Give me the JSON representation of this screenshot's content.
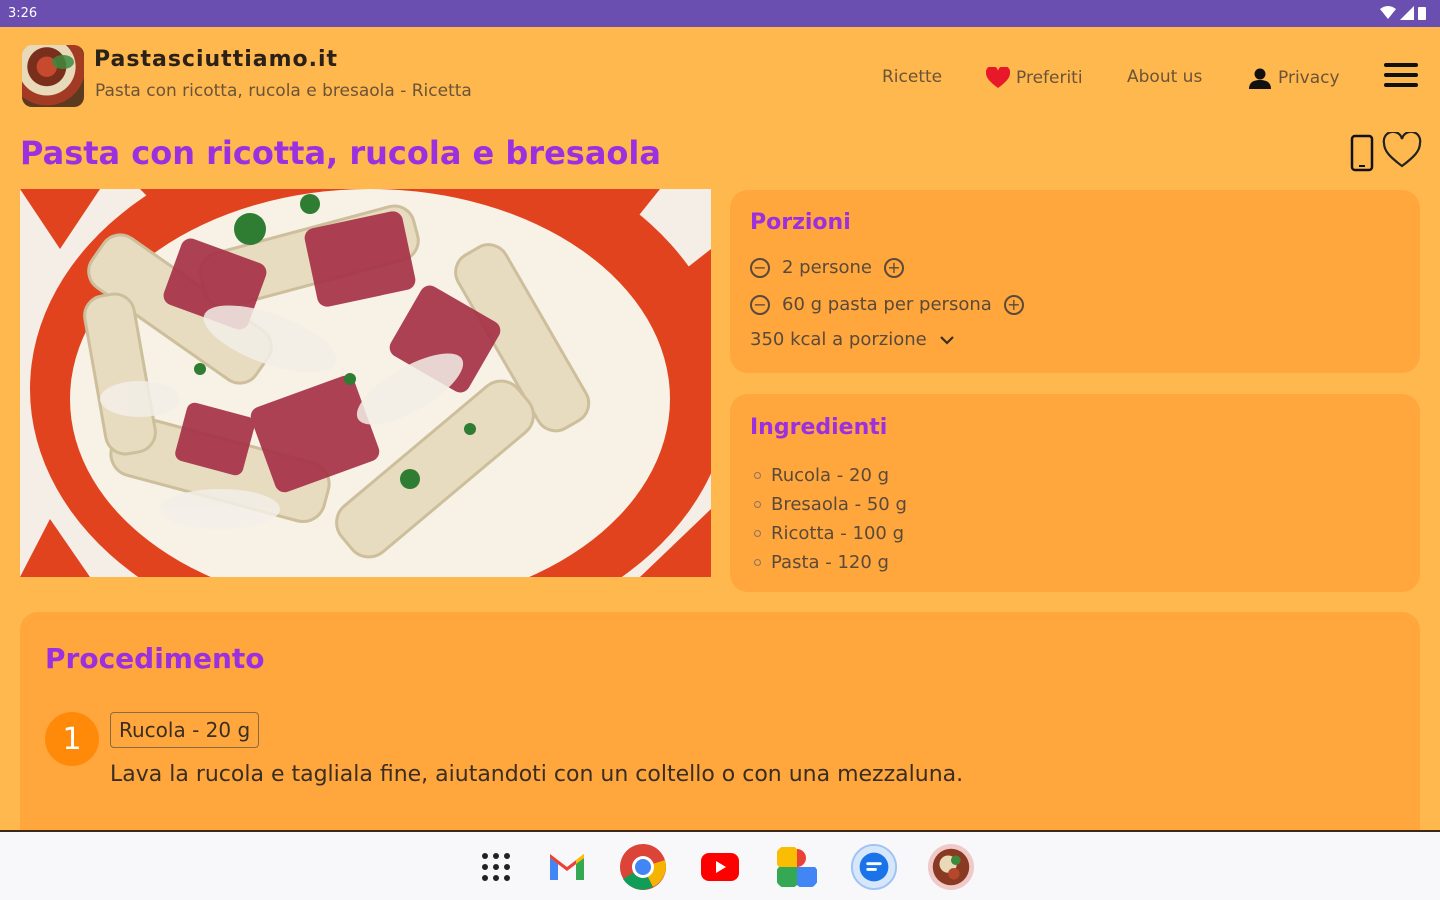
{
  "status_bar": {
    "time": "3:26"
  },
  "header": {
    "site_title": "Pastasciuttiamo.it",
    "subtitle": "Pasta con ricotta, rucola e bresaola - Ricetta",
    "nav": {
      "ricette": "Ricette",
      "preferiti": "Preferiti",
      "about": "About us",
      "privacy": "Privacy"
    }
  },
  "recipe": {
    "title": "Pasta con ricotta, rucola e bresaola"
  },
  "porzioni": {
    "title": "Porzioni",
    "persone": "2 persone",
    "pasta_per_persona": "60 g pasta per persona",
    "kcal": "350 kcal a porzione"
  },
  "ingredienti": {
    "title": "Ingredienti",
    "items": [
      "Rucola - 20 g",
      "Bresaola - 50 g",
      "Ricotta - 100 g",
      "Pasta - 120 g"
    ]
  },
  "procedimento": {
    "title": "Procedimento",
    "steps": [
      {
        "number": "1",
        "ingredient": "Rucola - 20 g",
        "text": "Lava la rucola e tagliala fine, aiutandoti con un coltello o con una mezzaluna."
      }
    ]
  },
  "dock": {
    "apps": [
      "app-drawer-icon",
      "gmail-icon",
      "chrome-icon",
      "youtube-icon",
      "photos-icon",
      "messages-icon",
      "pastasciuttiamo-app-icon"
    ]
  },
  "colors": {
    "background": "#FFB84D",
    "card": "#FFA63D",
    "accent_title": "#9B30E0",
    "step_badge": "#FF8A0A",
    "status_bar": "#6A4FB0"
  }
}
